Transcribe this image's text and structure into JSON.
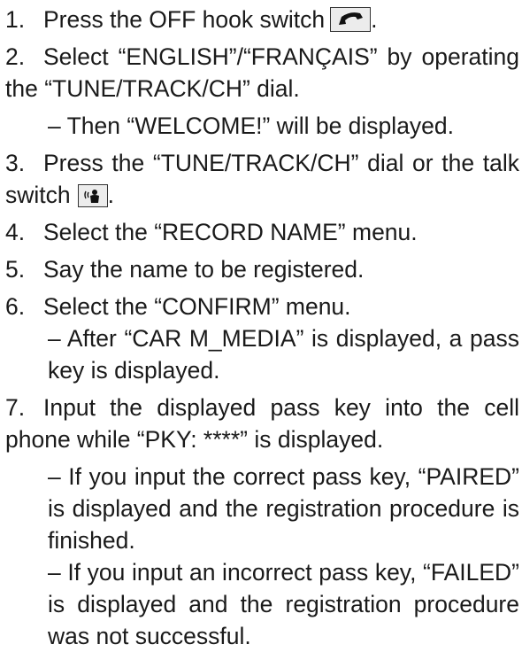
{
  "steps": [
    {
      "number": "1.",
      "text": "Press the OFF hook switch",
      "icon": "off-hook-phone-icon",
      "after_icon": "."
    },
    {
      "number": "2.",
      "text": "Select “ENGLISH”/“FRANÇAIS” by operating the “TUNE/TRACK/CH” dial.",
      "notes": [
        "– Then “WELCOME!” will be displayed."
      ]
    },
    {
      "number": "3.",
      "text": "Press the “TUNE/TRACK/CH” dial or the talk switch",
      "icon": "talk-voice-icon",
      "after_icon": "."
    },
    {
      "number": "4.",
      "text": "Select the “RECORD NAME” menu."
    },
    {
      "number": "5.",
      "text": "Say the name to be registered."
    },
    {
      "number": "6.",
      "text": "Select the “CONFIRM” menu.",
      "notes": [
        "– After “CAR M_MEDIA” is displayed, a pass key is displayed."
      ]
    },
    {
      "number": "7.",
      "text": "Input the displayed pass key into the cell phone while “PKY: ****” is displayed.",
      "notes": [
        "– If you input the correct pass key, “PAIRED” is displayed and the registration procedure is finished.",
        "– If you input an incorrect pass key, “FAILED” is displayed and the registration procedure was not successful."
      ]
    }
  ]
}
